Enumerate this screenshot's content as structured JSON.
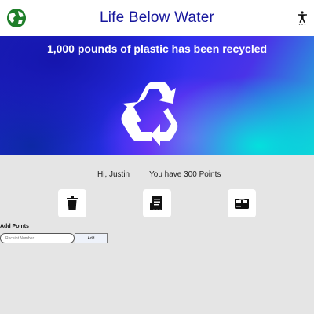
{
  "header": {
    "title": "Life Below Water",
    "home_icon": "globe-icon",
    "accessibility_icon": "accessibility-icon"
  },
  "hero": {
    "headline": "1,000 pounds of plastic has been recycled",
    "icon": "recycle-icon"
  },
  "user": {
    "greeting": "Hi, Justin",
    "points_text": "You have 300 Points"
  },
  "actions": [
    {
      "name": "trash",
      "icon": "trash-icon"
    },
    {
      "name": "receipt",
      "icon": "receipt-icon"
    },
    {
      "name": "gift-card",
      "icon": "gift-card-icon"
    }
  ],
  "add_points": {
    "label": "Add Points",
    "placeholder": "Receipt Number",
    "button_label": "Add"
  },
  "colors": {
    "title": "#16169c",
    "globe": "#1f7f2a",
    "background": "#e5e5e5"
  }
}
